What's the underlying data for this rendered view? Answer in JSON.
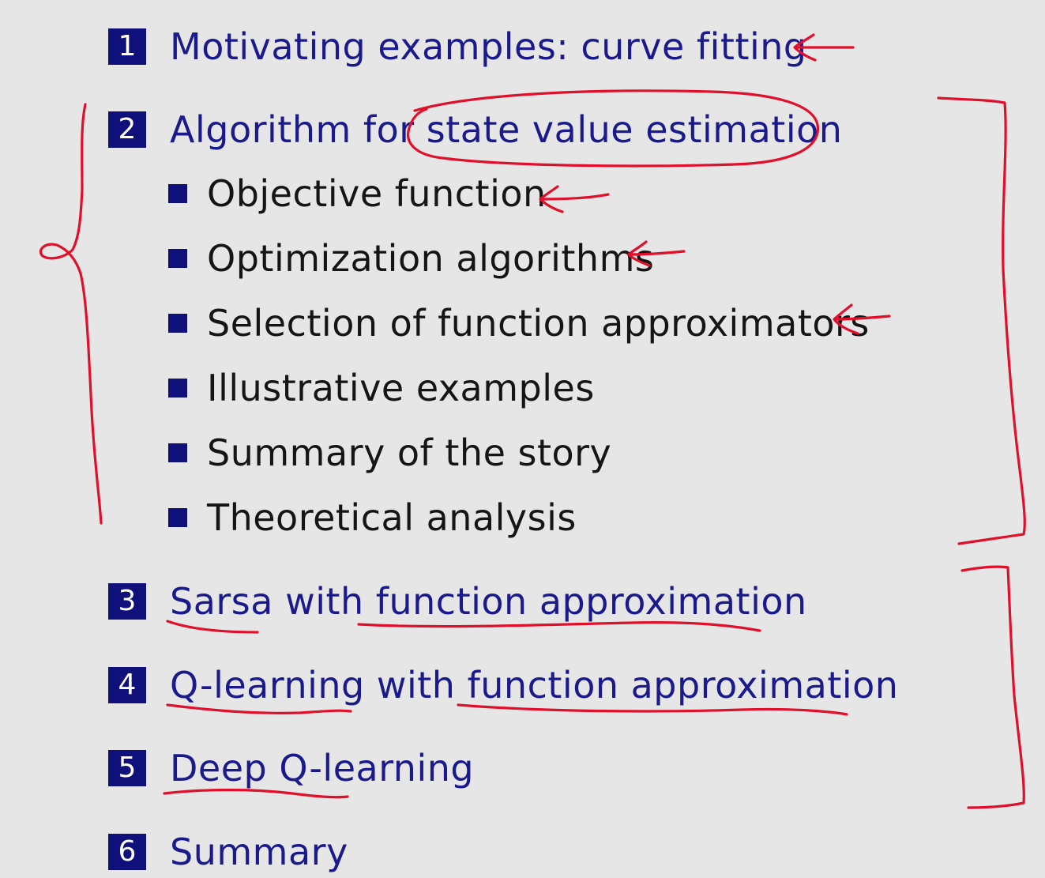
{
  "outline": {
    "sections": [
      {
        "number": "1",
        "title": "Motivating examples: curve fitting"
      },
      {
        "number": "2",
        "title": "Algorithm for state value estimation",
        "subsections": [
          "Objective function",
          "Optimization algorithms",
          "Selection of function approximators",
          "Illustrative examples",
          "Summary of the story",
          "Theoretical analysis"
        ]
      },
      {
        "number": "3",
        "title": "Sarsa with function approximation"
      },
      {
        "number": "4",
        "title": "Q-learning with function approximation"
      },
      {
        "number": "5",
        "title": "Deep Q-learning"
      },
      {
        "number": "6",
        "title": "Summary"
      }
    ]
  },
  "colors": {
    "section_box": "#10107a",
    "section_text": "#1a1a8c",
    "subsection_text": "#151515",
    "annotation_ink": "#e0102a",
    "background": "#e6e6e6"
  }
}
